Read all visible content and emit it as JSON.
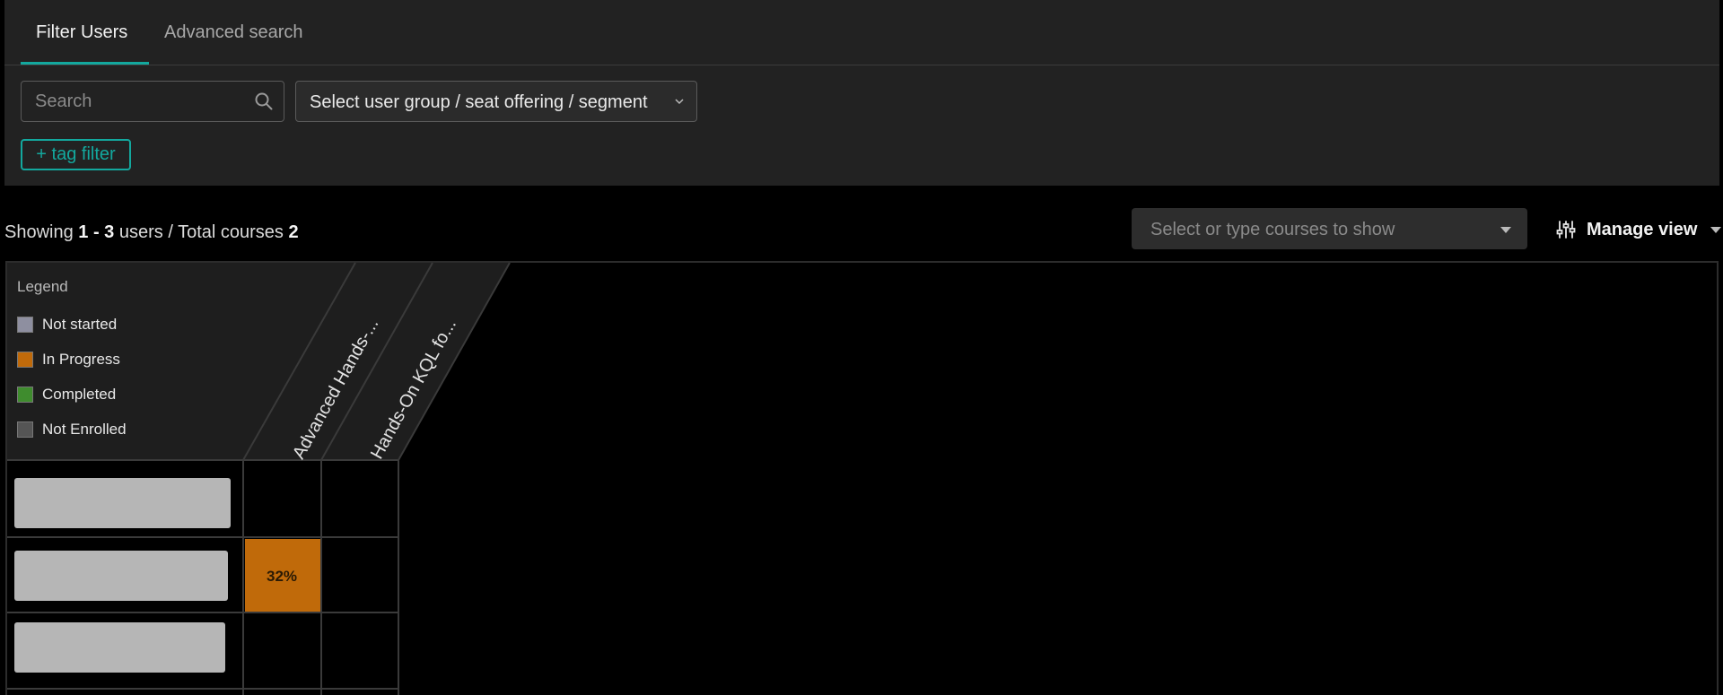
{
  "tabs": [
    {
      "label": "Filter Users",
      "active": true
    },
    {
      "label": "Advanced search",
      "active": false
    }
  ],
  "filters": {
    "search_placeholder": "Search",
    "group_select_label": "Select user group / seat offering / segment",
    "tag_filter_label": "+ tag filter"
  },
  "summary": {
    "prefix": "Showing",
    "range": "1 - 3",
    "users_text": "users / Total courses",
    "total_courses": "2"
  },
  "courses_select": {
    "placeholder": "Select or type courses to show"
  },
  "manage_view": {
    "label": "Manage view"
  },
  "legend": {
    "title": "Legend",
    "items": [
      {
        "label": "Not started",
        "color": "#8e8fa0"
      },
      {
        "label": "In Progress",
        "color": "#c06a0a"
      },
      {
        "label": "Completed",
        "color": "#3f8c2e"
      },
      {
        "label": "Not Enrolled",
        "color": "#555555"
      }
    ]
  },
  "courses": [
    {
      "label": "Advanced Hands-..."
    },
    {
      "label": "Hands-On KQL fo..."
    }
  ],
  "users": [
    {
      "cells": [
        null,
        null
      ]
    },
    {
      "cells": [
        {
          "status": "In Progress",
          "value": "32%"
        },
        null
      ]
    },
    {
      "cells": [
        null,
        null
      ]
    }
  ],
  "colors": {
    "accent": "#13a89e",
    "in_progress": "#c06a0a",
    "panel_bg": "#222222",
    "page_bg": "#000000"
  }
}
